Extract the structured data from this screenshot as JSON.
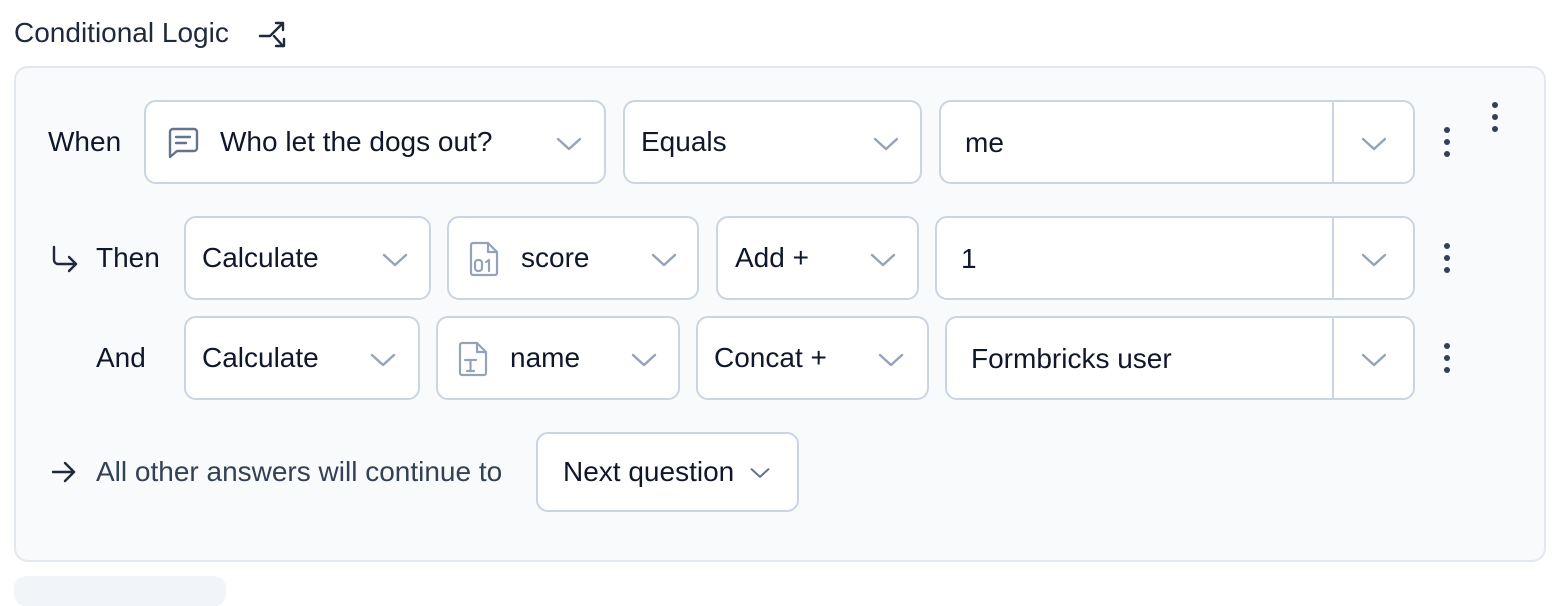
{
  "header": {
    "title": "Conditional Logic",
    "icon": "split-arrow-icon"
  },
  "when_row": {
    "label": "When",
    "question": "Who let the dogs out?",
    "question_icon": "message-square-icon",
    "operator": "Equals",
    "value": "me"
  },
  "then_row": {
    "label": "Then",
    "action": "Calculate",
    "variable": "score",
    "variable_icon": "file-digit-icon",
    "operator": "Add +",
    "value": "1"
  },
  "and_row": {
    "label": "And",
    "action": "Calculate",
    "variable": "name",
    "variable_icon": "file-type-icon",
    "operator": "Concat +",
    "value": "Formbricks user"
  },
  "fallback": {
    "text": "All other answers will continue to",
    "target": "Next question"
  },
  "colors": {
    "panel_bg": "#f8fafc",
    "border": "#cbd5e1",
    "text": "#0f172a",
    "icon": "#64748b"
  }
}
